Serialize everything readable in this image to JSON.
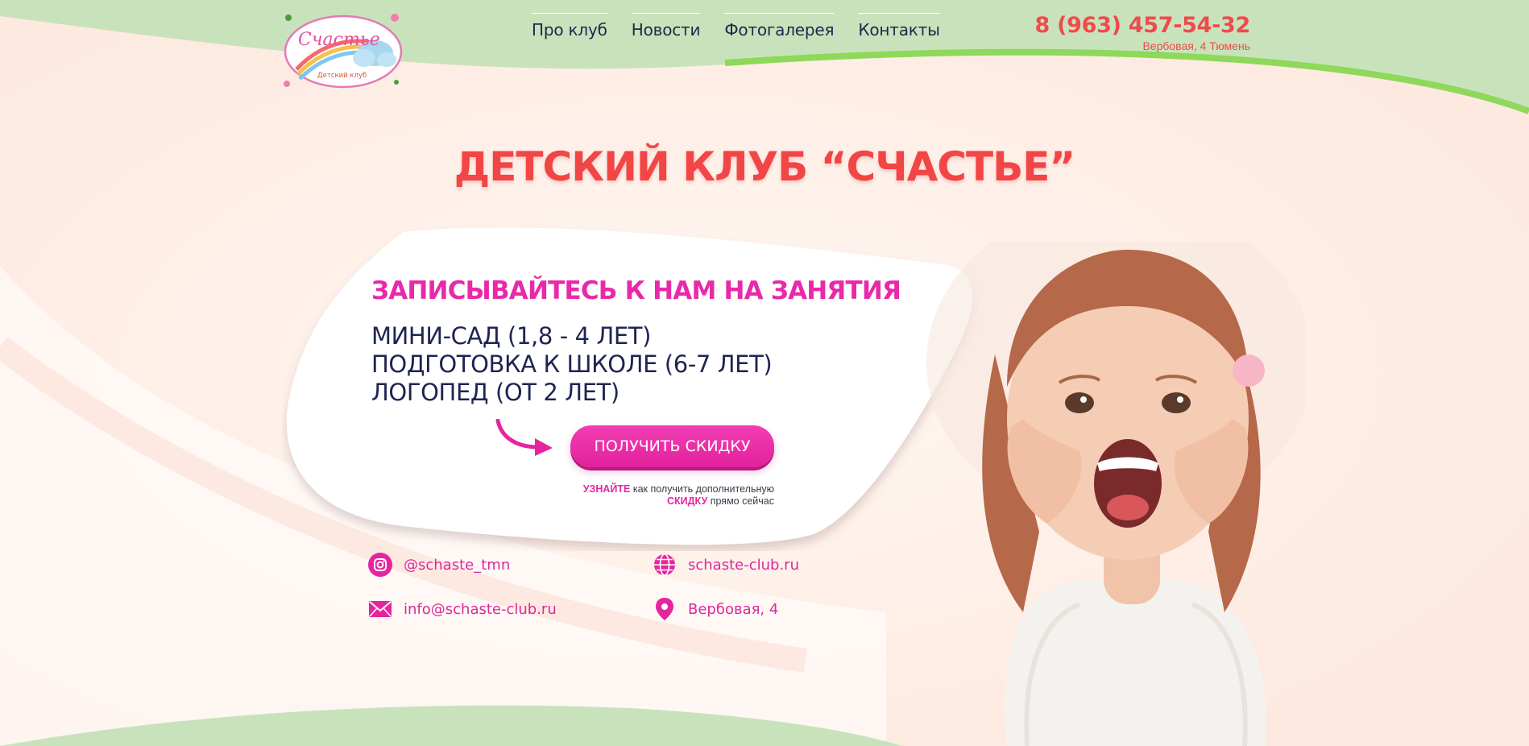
{
  "logo": {
    "script_text": "Счастье",
    "caption": "Детский клуб"
  },
  "nav": {
    "items": [
      {
        "label": "Про клуб"
      },
      {
        "label": "Новости"
      },
      {
        "label": "Фотогалерея"
      },
      {
        "label": "Контакты"
      }
    ]
  },
  "header": {
    "phone": "8 (963) 457-54-32",
    "address": "Вербовая, 4 Тюмень"
  },
  "hero": {
    "title": "ДЕТСКИЙ КЛУБ “СЧАСТЬЕ”",
    "cta_heading": "ЗАПИСЫВАЙТЕСЬ К НАМ НА ЗАНЯТИЯ",
    "programs": [
      "МИНИ-САД (1,8 - 4 ЛЕТ)",
      "ПОДГОТОВКА К ШКОЛЕ (6-7 ЛЕТ)",
      "ЛОГОПЕД (ОТ 2 ЛЕТ)"
    ],
    "button_label": "ПОЛУЧИТЬ СКИДКУ",
    "note": {
      "part1_highlight": "УЗНАЙТЕ",
      "part1_text": "как получить дополнительную",
      "part2_highlight": "СКИДКУ",
      "part2_text": "прямо сейчас"
    }
  },
  "contacts": {
    "instagram": "@schaste_tmn",
    "website": "schaste-club.ru",
    "email": "info@schaste-club.ru",
    "address": "Вербовая, 4"
  },
  "colors": {
    "accent_pink": "#e829a9",
    "accent_red": "#f24545",
    "nav_text": "#22284b",
    "header_green": "#c8e3bc",
    "line_green": "#8ed85a",
    "background": "#fff3ec"
  },
  "icons": [
    "instagram-icon",
    "globe-icon",
    "mail-icon",
    "location-pin-icon",
    "arrow-icon"
  ]
}
